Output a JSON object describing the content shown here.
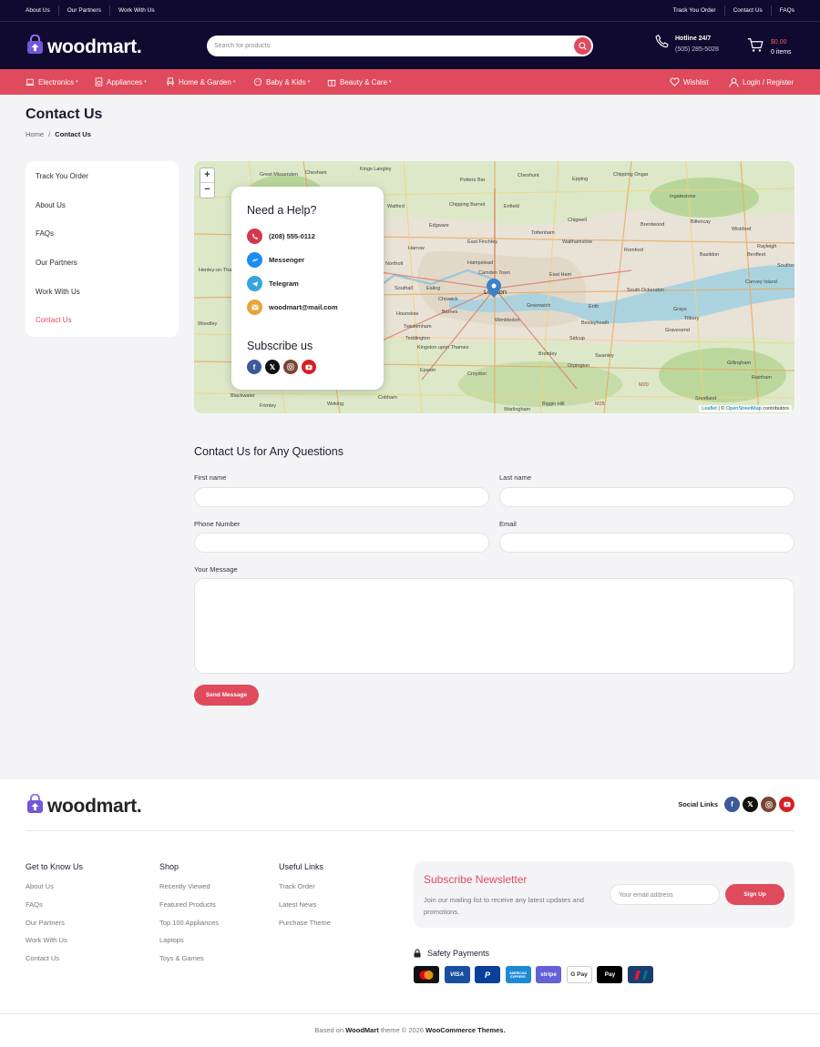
{
  "topbar": {
    "left_links": [
      "About Us",
      "Our Partners",
      "Work With Us"
    ],
    "right_links": [
      "Track You Order",
      "Contact Us",
      "FAQs"
    ]
  },
  "header": {
    "logo_text": "woodmart.",
    "search_placeholder": "Search for products",
    "hotline_label": "Hotline 24/7",
    "hotline_number": "(505) 285-5028",
    "cart_total": "$0.00",
    "cart_items": "0 items"
  },
  "nav": {
    "items": [
      "Electronics",
      "Appliances",
      "Home & Garden",
      "Baby & Kids",
      "Beauty & Care"
    ],
    "wishlist": "Wishlist",
    "login": "Login / Register"
  },
  "page": {
    "title": "Contact Us",
    "breadcrumb_home": "Home",
    "breadcrumb_sep": "/",
    "breadcrumb_current": "Contact Us"
  },
  "sidebar": {
    "items": [
      "Track You Order",
      "About Us",
      "FAQs",
      "Our Partners",
      "Work With Us",
      "Contact Us"
    ],
    "active": "Contact Us"
  },
  "map": {
    "zoom_in": "+",
    "zoom_out": "−",
    "attribution_lib": "Leaflet",
    "attribution_sep": "| ©",
    "attribution_osm": "OpenStreetMap",
    "attribution_tail": "contributors",
    "place_labels": [
      "Great Missenden",
      "Chesham",
      "Kings Langley",
      "Potters Bar",
      "Cheshunt",
      "Epping",
      "Chipping Ongar",
      "Ingatestone",
      "Watford",
      "Chipping Barnet",
      "Enfield",
      "Chigwell",
      "Brentwood",
      "Billericay",
      "Wickford",
      "Edgware",
      "Harrow",
      "East Finchley",
      "Tottenham",
      "Walthamstow",
      "Romford",
      "Basildon",
      "Benfleet",
      "Hampstead",
      "Camden Town",
      "East Ham",
      "Northolt",
      "Southall",
      "Ealing",
      "London",
      "Greenwich",
      "South Ockendon",
      "Canvey Island",
      "Hounslow",
      "Barnes",
      "Chiswick",
      "Erith",
      "Grays",
      "Tilbury",
      "Twickenham",
      "Wimbledon",
      "Bexleyheath",
      "Gravesend",
      "Teddington",
      "Kingston upon Thames",
      "Sidcup",
      "Bromley",
      "Croydon",
      "Swanley",
      "Orpington",
      "Epsom",
      "Woking",
      "Cobham",
      "Biggin Hill",
      "Warlingham",
      "Gillingham",
      "Rainham",
      "Snodland",
      "M25",
      "M20",
      "Henley-on-Thames",
      "Woodley",
      "Blackwater",
      "Frimley",
      "Rayleigh",
      "Southend-on-Sea"
    ]
  },
  "help": {
    "title": "Need a Help?",
    "phone": "(208) 555-0112",
    "messenger": "Messenger",
    "telegram": "Telegram",
    "email": "woodmart@mail.com",
    "subscribe": "Subscribe us"
  },
  "form": {
    "title": "Contact Us for Any Questions",
    "first_name": "First name",
    "last_name": "Last name",
    "phone": "Phone Number",
    "email": "Email",
    "message": "Your Message",
    "submit": "Send Message"
  },
  "footer": {
    "logo_text": "woodmart.",
    "social_label": "Social Links",
    "col1": {
      "title": "Get to Know Us",
      "links": [
        "About Us",
        "FAQs",
        "Our Partners",
        "Work With Us",
        "Contact Us"
      ]
    },
    "col2": {
      "title": "Shop",
      "links": [
        "Recently Viewed",
        "Featured Products",
        "Top 100 Appliances",
        "Laptops",
        "Toys & Games"
      ]
    },
    "col3": {
      "title": "Useful Links",
      "links": [
        "Track Order",
        "Latest News",
        "Purchase Theme"
      ]
    },
    "newsletter_title": "Subscribe Newsletter",
    "newsletter_text": "Join our mailing list to receive any latest updates and promotions.",
    "newsletter_placeholder": "Your email address",
    "newsletter_button": "Sign Up",
    "safety_title": "Safety Payments",
    "payments": [
      "mastercard",
      "VISA",
      "paypal",
      "AMERICAN EXPRESS",
      "stripe",
      "G Pay",
      "Pay",
      "unionpay"
    ],
    "copy_pre": "Based on",
    "copy_brand": "WoodMart",
    "copy_mid": "theme © 2026",
    "copy_themes": "WooCommerce Themes."
  },
  "colors": {
    "dark_navy": "#100a30",
    "accent": "#df4a5c",
    "logo_purple": "#7357d9",
    "page_bg": "#f4f4f7"
  }
}
